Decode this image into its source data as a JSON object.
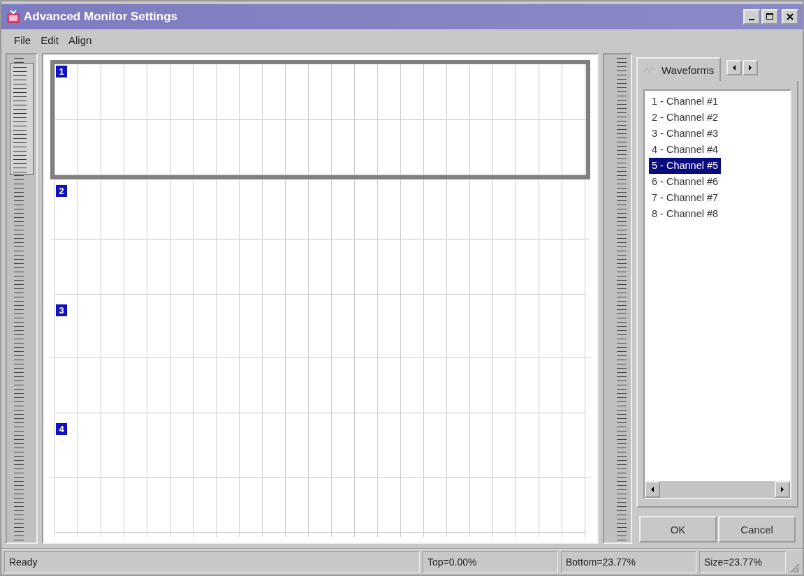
{
  "window": {
    "title": "Advanced Monitor Settings"
  },
  "menu": [
    {
      "label": "File"
    },
    {
      "label": "Edit"
    },
    {
      "label": "Align"
    }
  ],
  "panels": [
    {
      "label": "1",
      "selected": true
    },
    {
      "label": "2",
      "selected": false
    },
    {
      "label": "3",
      "selected": false
    },
    {
      "label": "4",
      "selected": false
    }
  ],
  "tabs": [
    {
      "label": "Waveforms",
      "selected": true
    }
  ],
  "channels": [
    {
      "label": "1 - Channel #1",
      "selected": false
    },
    {
      "label": "2 - Channel #2",
      "selected": false
    },
    {
      "label": "3 - Channel #3",
      "selected": false
    },
    {
      "label": "4 - Channel #4",
      "selected": false
    },
    {
      "label": "5 - Channel #5",
      "selected": true
    },
    {
      "label": "6 - Channel #6",
      "selected": false
    },
    {
      "label": "7 - Channel #7",
      "selected": false
    },
    {
      "label": "8 - Channel #8",
      "selected": false
    }
  ],
  "buttons": [
    {
      "label": "OK"
    },
    {
      "label": "Cancel"
    }
  ],
  "status_bar": {
    "message": "Ready",
    "top": "Top=0.00%",
    "bottom": "Bottom=23.77%",
    "size": "Size=23.77%"
  }
}
